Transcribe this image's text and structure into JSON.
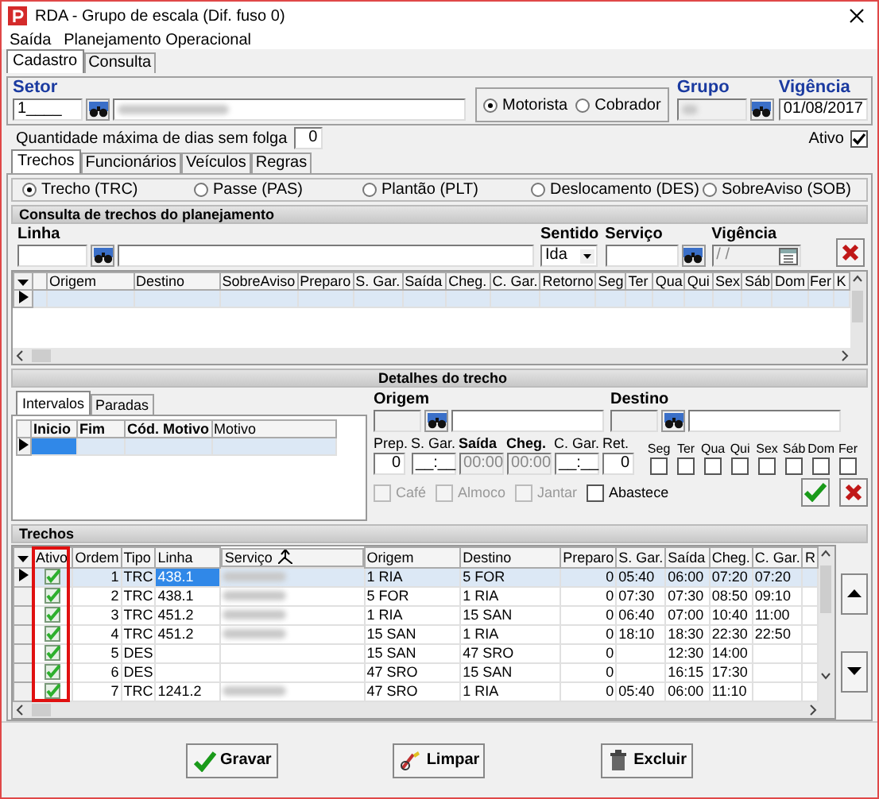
{
  "window": {
    "title": "RDA - Grupo de escala (Dif. fuso 0)"
  },
  "menu": [
    {
      "label": "Saída"
    },
    {
      "label": "Planejamento Operacional"
    }
  ],
  "main_tabs": [
    {
      "label": "Cadastro",
      "selected": true
    },
    {
      "label": "Consulta",
      "selected": false
    }
  ],
  "header": {
    "setor_label": "Setor",
    "setor_value": "1____",
    "setor_name_blurred": true,
    "role_options": [
      {
        "label": "Motorista",
        "selected": true
      },
      {
        "label": "Cobrador",
        "selected": false
      }
    ],
    "grupo_label": "Grupo",
    "grupo_blurred": true,
    "vigencia_label": "Vigência",
    "vigencia_value": "01/08/2017"
  },
  "folga": {
    "label": "Quantidade máxima de dias sem folga",
    "value": "0"
  },
  "ativo": {
    "label": "Ativo",
    "checked": true
  },
  "sub_tabs": [
    {
      "label": "Trechos",
      "selected": true
    },
    {
      "label": "Funcionários",
      "selected": false
    },
    {
      "label": "Veículos",
      "selected": false
    },
    {
      "label": "Regras",
      "selected": false
    }
  ],
  "type_options": [
    {
      "label": "Trecho (TRC)",
      "selected": true
    },
    {
      "label": "Passe (PAS)",
      "selected": false
    },
    {
      "label": "Plantão (PLT)",
      "selected": false
    },
    {
      "label": "Deslocamento (DES)",
      "selected": false
    },
    {
      "label": "SobreAviso (SOB)",
      "selected": false
    }
  ],
  "consulta": {
    "title": "Consulta de trechos do planejamento",
    "linha_label": "Linha",
    "sentido_label": "Sentido",
    "sentido_value": "Ida",
    "servico_label": "Serviço",
    "vigencia_label": "Vigência",
    "vigencia_value": "/ /",
    "columns": [
      "Origem",
      "Destino",
      "SobreAviso",
      "Preparo",
      "S. Gar.",
      "Saída",
      "Cheg.",
      "C. Gar.",
      "Retorno",
      "Seg",
      "Ter",
      "Qua",
      "Qui",
      "Sex",
      "Sáb",
      "Dom",
      "Fer",
      "K"
    ]
  },
  "detalhes": {
    "title": "Detalhes do trecho",
    "tabs": [
      {
        "label": "Intervalos",
        "selected": true
      },
      {
        "label": "Paradas",
        "selected": false
      }
    ],
    "columns": [
      {
        "label": "Inicio",
        "bold": true
      },
      {
        "label": "Fim",
        "bold": true
      },
      {
        "label": "Cód. Motivo",
        "bold": true
      },
      {
        "label": "Motivo",
        "bold": false
      }
    ],
    "origem_label": "Origem",
    "destino_label": "Destino",
    "fields": [
      {
        "label": "Prep.",
        "value": "0",
        "bold": false,
        "disabled": false
      },
      {
        "label": "S. Gar.",
        "value": "__:__",
        "bold": false,
        "disabled": false
      },
      {
        "label": "Saída",
        "value": "00:00",
        "bold": true,
        "disabled": true
      },
      {
        "label": "Cheg.",
        "value": "00:00",
        "bold": true,
        "disabled": true
      },
      {
        "label": "C. Gar.",
        "value": "__:__",
        "bold": false,
        "disabled": false
      },
      {
        "label": "Ret.",
        "value": "0",
        "bold": false,
        "disabled": false
      }
    ],
    "days": [
      {
        "label": "Seg",
        "checked": false
      },
      {
        "label": "Ter",
        "checked": false
      },
      {
        "label": "Qua",
        "checked": false
      },
      {
        "label": "Qui",
        "checked": false
      },
      {
        "label": "Sex",
        "checked": false
      },
      {
        "label": "Sáb",
        "checked": false
      },
      {
        "label": "Dom",
        "checked": false
      },
      {
        "label": "Fer",
        "checked": false
      }
    ],
    "options": [
      {
        "label": "Café",
        "checked": false,
        "disabled": true
      },
      {
        "label": "Almoco",
        "checked": false,
        "disabled": true
      },
      {
        "label": "Jantar",
        "checked": false,
        "disabled": true
      },
      {
        "label": "Abastece",
        "checked": false,
        "disabled": false
      }
    ]
  },
  "trechos": {
    "title": "Trechos",
    "columns": [
      "Ativo",
      "Ordem",
      "Tipo",
      "Linha",
      "Serviço",
      "Origem",
      "Destino",
      "Preparo",
      "S. Gar.",
      "Saída",
      "Cheg.",
      "C. Gar.",
      "R"
    ],
    "rows": [
      {
        "selected": true,
        "ativo": true,
        "ordem": "1",
        "tipo": "TRC",
        "linha": "438.1",
        "servico_blurred": true,
        "origem": "1 RIA",
        "destino": "5 FOR",
        "preparo": "0",
        "s_gar": "05:40",
        "saida": "06:00",
        "cheg": "07:20",
        "c_gar": "07:20"
      },
      {
        "selected": false,
        "ativo": true,
        "ordem": "2",
        "tipo": "TRC",
        "linha": "438.1",
        "servico_blurred": true,
        "origem": "5 FOR",
        "destino": "1 RIA",
        "preparo": "0",
        "s_gar": "07:30",
        "saida": "07:30",
        "cheg": "08:50",
        "c_gar": "09:10"
      },
      {
        "selected": false,
        "ativo": true,
        "ordem": "3",
        "tipo": "TRC",
        "linha": "451.2",
        "servico_blurred": true,
        "origem": "1 RIA",
        "destino": "15 SAN",
        "preparo": "0",
        "s_gar": "06:40",
        "saida": "07:00",
        "cheg": "10:40",
        "c_gar": "11:00"
      },
      {
        "selected": false,
        "ativo": true,
        "ordem": "4",
        "tipo": "TRC",
        "linha": "451.2",
        "servico_blurred": true,
        "origem": "15 SAN",
        "destino": "1 RIA",
        "preparo": "0",
        "s_gar": "18:10",
        "saida": "18:30",
        "cheg": "22:30",
        "c_gar": "22:50"
      },
      {
        "selected": false,
        "ativo": true,
        "ordem": "5",
        "tipo": "DES",
        "origem": "15 SAN",
        "destino": "47 SRO",
        "preparo": "0",
        "saida": "12:30",
        "cheg": "14:00"
      },
      {
        "selected": false,
        "ativo": true,
        "ordem": "6",
        "tipo": "DES",
        "origem": "47 SRO",
        "destino": "15 SAN",
        "preparo": "0",
        "saida": "16:15",
        "cheg": "17:30"
      },
      {
        "selected": false,
        "ativo": true,
        "ordem": "7",
        "tipo": "TRC",
        "linha": "1241.2",
        "servico_blurred": true,
        "origem": "47 SRO",
        "destino": "1 RIA",
        "preparo": "0",
        "s_gar": "05:40",
        "saida": "06:00",
        "cheg": "11:10"
      }
    ]
  },
  "buttons": [
    {
      "label": "Gravar",
      "kind": "save"
    },
    {
      "label": "Limpar",
      "kind": "clear"
    },
    {
      "label": "Excluir",
      "kind": "delete"
    }
  ]
}
